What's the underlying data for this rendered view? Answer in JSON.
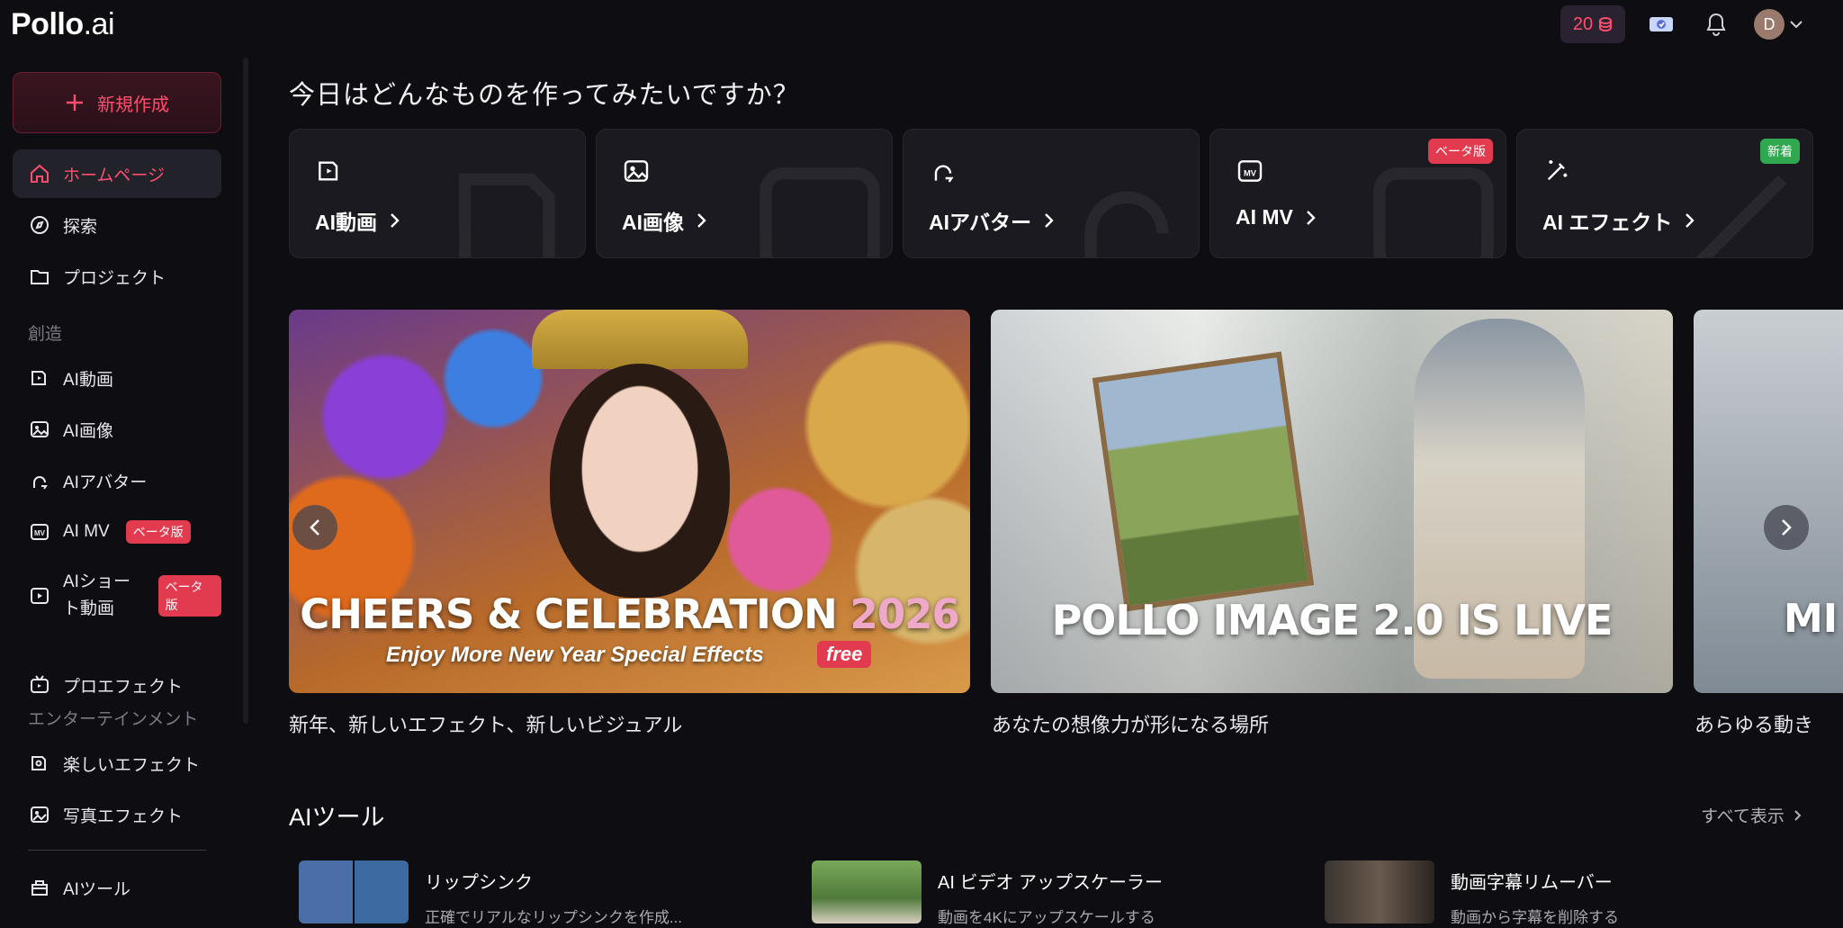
{
  "header": {
    "logo_main": "Pollo",
    "logo_suffix": ".ai",
    "credits": "20",
    "avatar_initial": "D"
  },
  "sidebar": {
    "new_button": "新規作成",
    "items": [
      {
        "label": "ホームページ"
      },
      {
        "label": "探索"
      },
      {
        "label": "プロジェクト"
      }
    ],
    "section_create": "創造",
    "create_items": [
      {
        "label": "AI動画"
      },
      {
        "label": "AI画像"
      },
      {
        "label": "AIアバター"
      },
      {
        "label": "AI MV",
        "badge": "ベータ版"
      },
      {
        "label": "AIショート動画",
        "badge": "ベータ版"
      },
      {
        "label": "プロエフェクト"
      }
    ],
    "section_entertainment": "エンターテインメント",
    "ent_items": [
      {
        "label": "楽しいエフェクト"
      },
      {
        "label": "写真エフェクト"
      }
    ],
    "tools_item": "AIツール"
  },
  "main": {
    "title": "今日はどんなものを作ってみたいですか？",
    "cards": [
      {
        "label": "AI動画"
      },
      {
        "label": "AI画像"
      },
      {
        "label": "AIアバター"
      },
      {
        "label": "AI MV",
        "tag": "ベータ版"
      },
      {
        "label": "AI エフェクト",
        "tag": "新着"
      }
    ],
    "banners": [
      {
        "headline_main": "CHEERS & CELEBRATION",
        "headline_year": "2026",
        "sub": "Enjoy More New Year Special Effects",
        "free": "free",
        "caption": "新年、新しいエフェクト、新しいビジュアル"
      },
      {
        "headline_main": "POLLO IMAGE 2.0 IS LIVE",
        "caption": "あなたの想像力が形になる場所"
      },
      {
        "headline_main": "MI",
        "caption": "あらゆる動き"
      }
    ],
    "tools": {
      "title": "AIツール",
      "see_all": "すべて表示",
      "items": [
        {
          "name": "リップシンク",
          "desc": "正確でリアルなリップシンクを作成..."
        },
        {
          "name": "AI ビデオ アップスケーラー",
          "desc": "動画を4Kにアップスケールする"
        },
        {
          "name": "動画字幕リムーバー",
          "desc": "動画から字幕を削除する"
        }
      ]
    }
  },
  "colors": {
    "accent": "#ff4d6d",
    "background": "#0e0e12",
    "beta": "#e23b4f",
    "new": "#2fa84f"
  }
}
